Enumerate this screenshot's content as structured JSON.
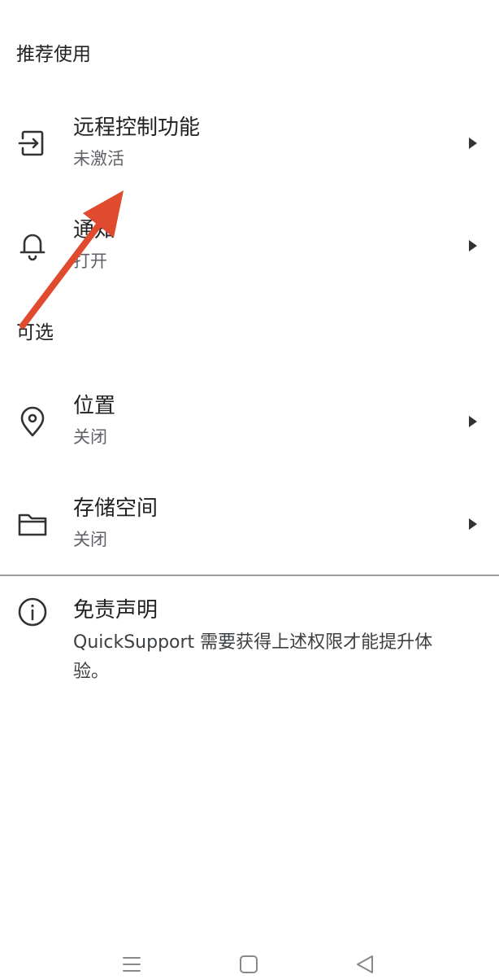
{
  "sections": {
    "recommended": "推荐使用",
    "optional": "可选"
  },
  "items": {
    "remote_control": {
      "title": "远程控制功能",
      "status": "未激活",
      "icon": "remote-control-icon"
    },
    "notifications": {
      "title": "通知",
      "status": "打开",
      "icon": "bell-icon"
    },
    "location": {
      "title": "位置",
      "status": "关闭",
      "icon": "location-pin-icon"
    },
    "storage": {
      "title": "存储空间",
      "status": "关闭",
      "icon": "folder-icon"
    }
  },
  "disclaimer": {
    "title": "免责声明",
    "body": "QuickSupport 需要获得上述权限才能提升体验。",
    "icon": "info-icon"
  },
  "annotation": {
    "color": "#e04a2f"
  },
  "navbar": {
    "icons": [
      "menu-icon",
      "home-icon",
      "back-icon"
    ]
  }
}
